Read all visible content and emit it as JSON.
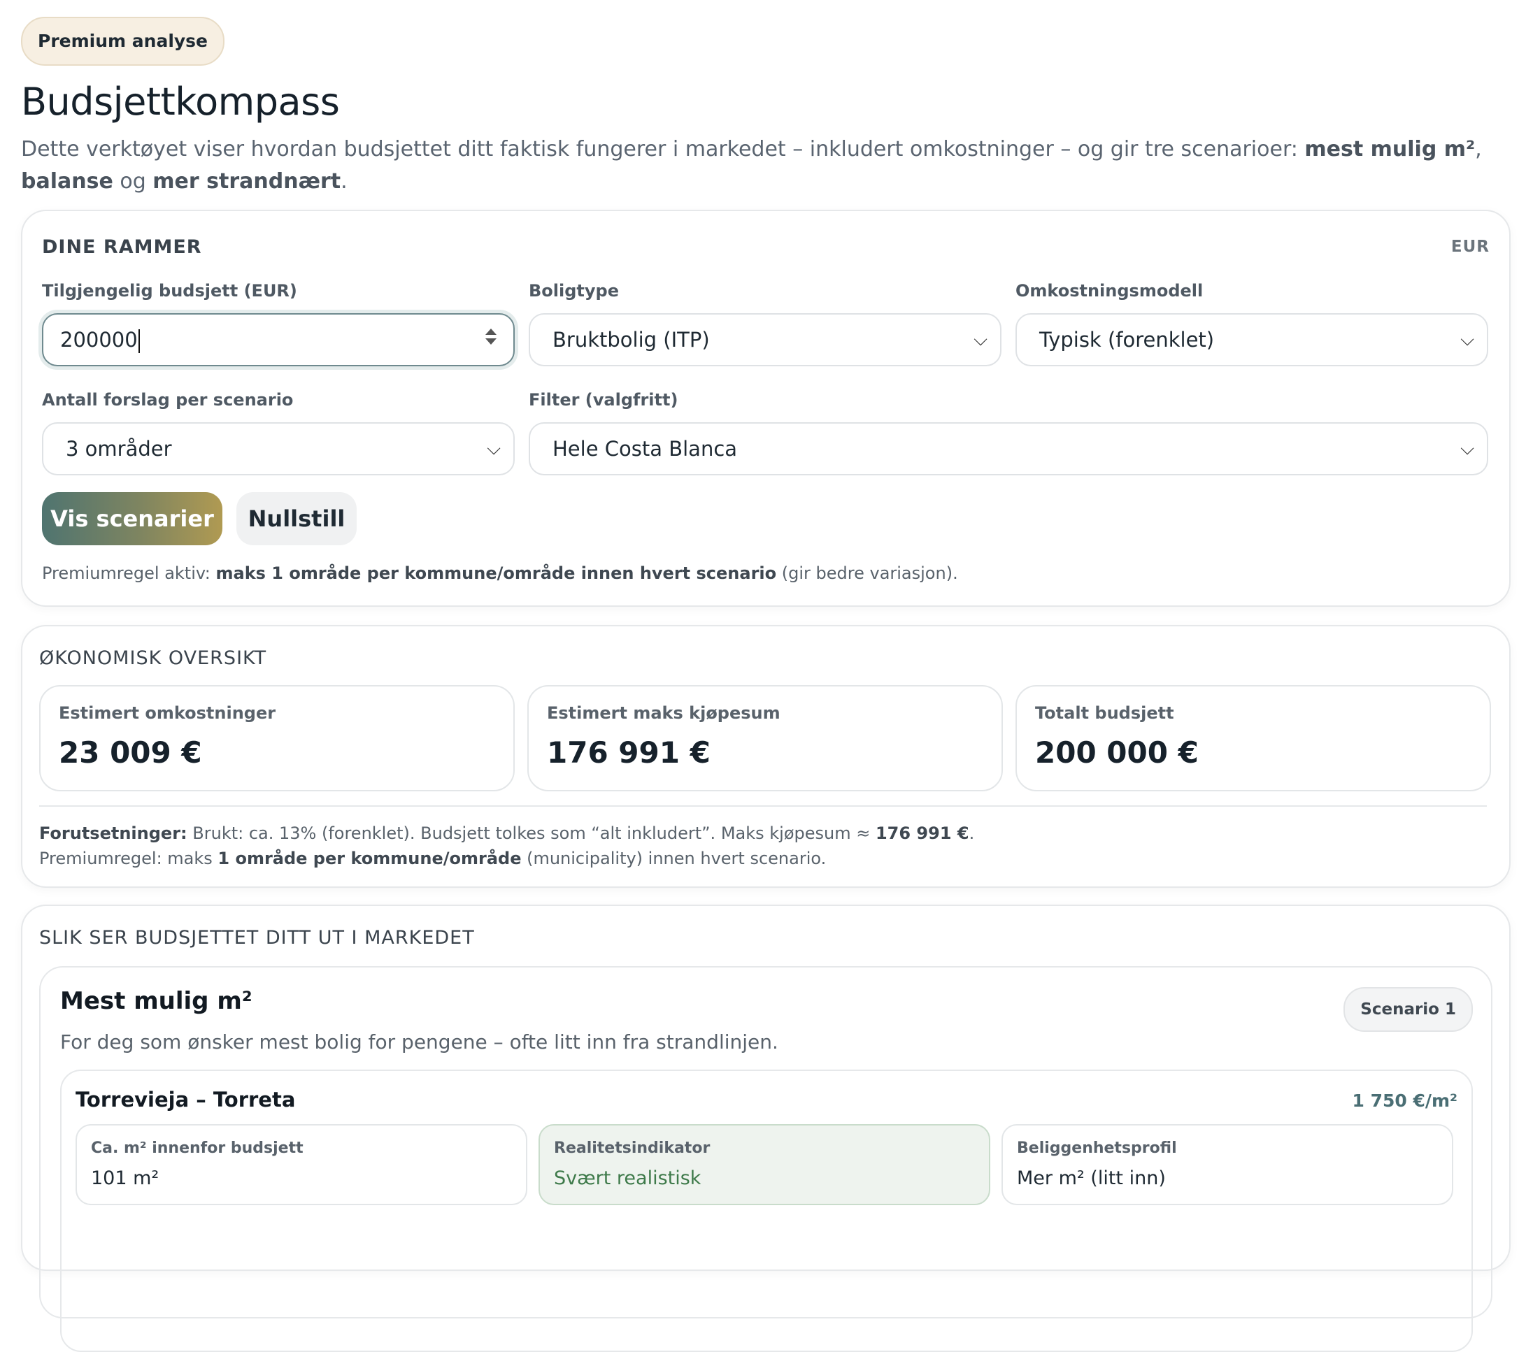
{
  "header": {
    "badge": "Premium analyse",
    "title": "Budsjettkompass",
    "lede_1": "Dette verktøyet viser hvordan budsjettet ditt faktisk fungerer i markedet – inkludert omkostninger – og gir tre scenarioer: ",
    "lede_b1": "mest mulig m²",
    "lede_2": ", ",
    "lede_b2": "balanse",
    "lede_3": " og ",
    "lede_b3": "mer strandnært",
    "lede_4": "."
  },
  "rammer": {
    "title": "DINE RAMMER",
    "currency": "EUR",
    "budget_label": "Tilgjengelig budsjett (EUR)",
    "budget_value": "200000",
    "type_label": "Boligtype",
    "type_value": "Bruktbolig (ITP)",
    "cost_label": "Omkostningsmodell",
    "cost_value": "Typisk (forenklet)",
    "count_label": "Antall forslag per scenario",
    "count_value": "3 områder",
    "filter_label": "Filter (valgfritt)",
    "filter_value": "Hele Costa Blanca",
    "show_button": "Vis scenarier",
    "reset_button": "Nullstill",
    "rule_1": "Premiumregel aktiv: ",
    "rule_b": "maks 1 område per kommune/område innen hvert scenario",
    "rule_2": " (gir bedre variasjon)."
  },
  "okonomi": {
    "title": "ØKONOMISK OVERSIKT",
    "stats": [
      {
        "label": "Estimert omkostninger",
        "value": "23 009 €"
      },
      {
        "label": "Estimert maks kjøpesum",
        "value": "176 991 €"
      },
      {
        "label": "Totalt budsjett",
        "value": "200 000 €"
      }
    ],
    "assume_b": "Forutsetninger:",
    "assume_1": " Brukt: ca. 13% (forenklet). Budsjett tolkes som “alt inkludert”. Maks kjøpesum ≈ ",
    "assume_b2": "176 991 €",
    "assume_2": ".",
    "rule_1": "Premiumregel: maks ",
    "rule_b": "1 område per kommune/område",
    "rule_2": " (municipality) innen hvert scenario."
  },
  "marked": {
    "title": "SLIK SER BUDSJETTET DITT UT I MARKEDET",
    "scenario": {
      "heading": "Mest mulig m²",
      "pill": "Scenario 1",
      "description": "For deg som ønsker mest bolig for pengene – ofte litt inn fra strandlinjen.",
      "area": {
        "name": "Torrevieja – Torreta",
        "price": "1 750 €/m²",
        "m2_label": "Ca. m² innenfor budsjett",
        "m2_value": "101 m²",
        "real_label": "Realitetsindikator",
        "real_value": "Svært realistisk",
        "profile_label": "Beliggenhetsprofil",
        "profile_value": "Mer m² (litt inn)"
      }
    }
  }
}
